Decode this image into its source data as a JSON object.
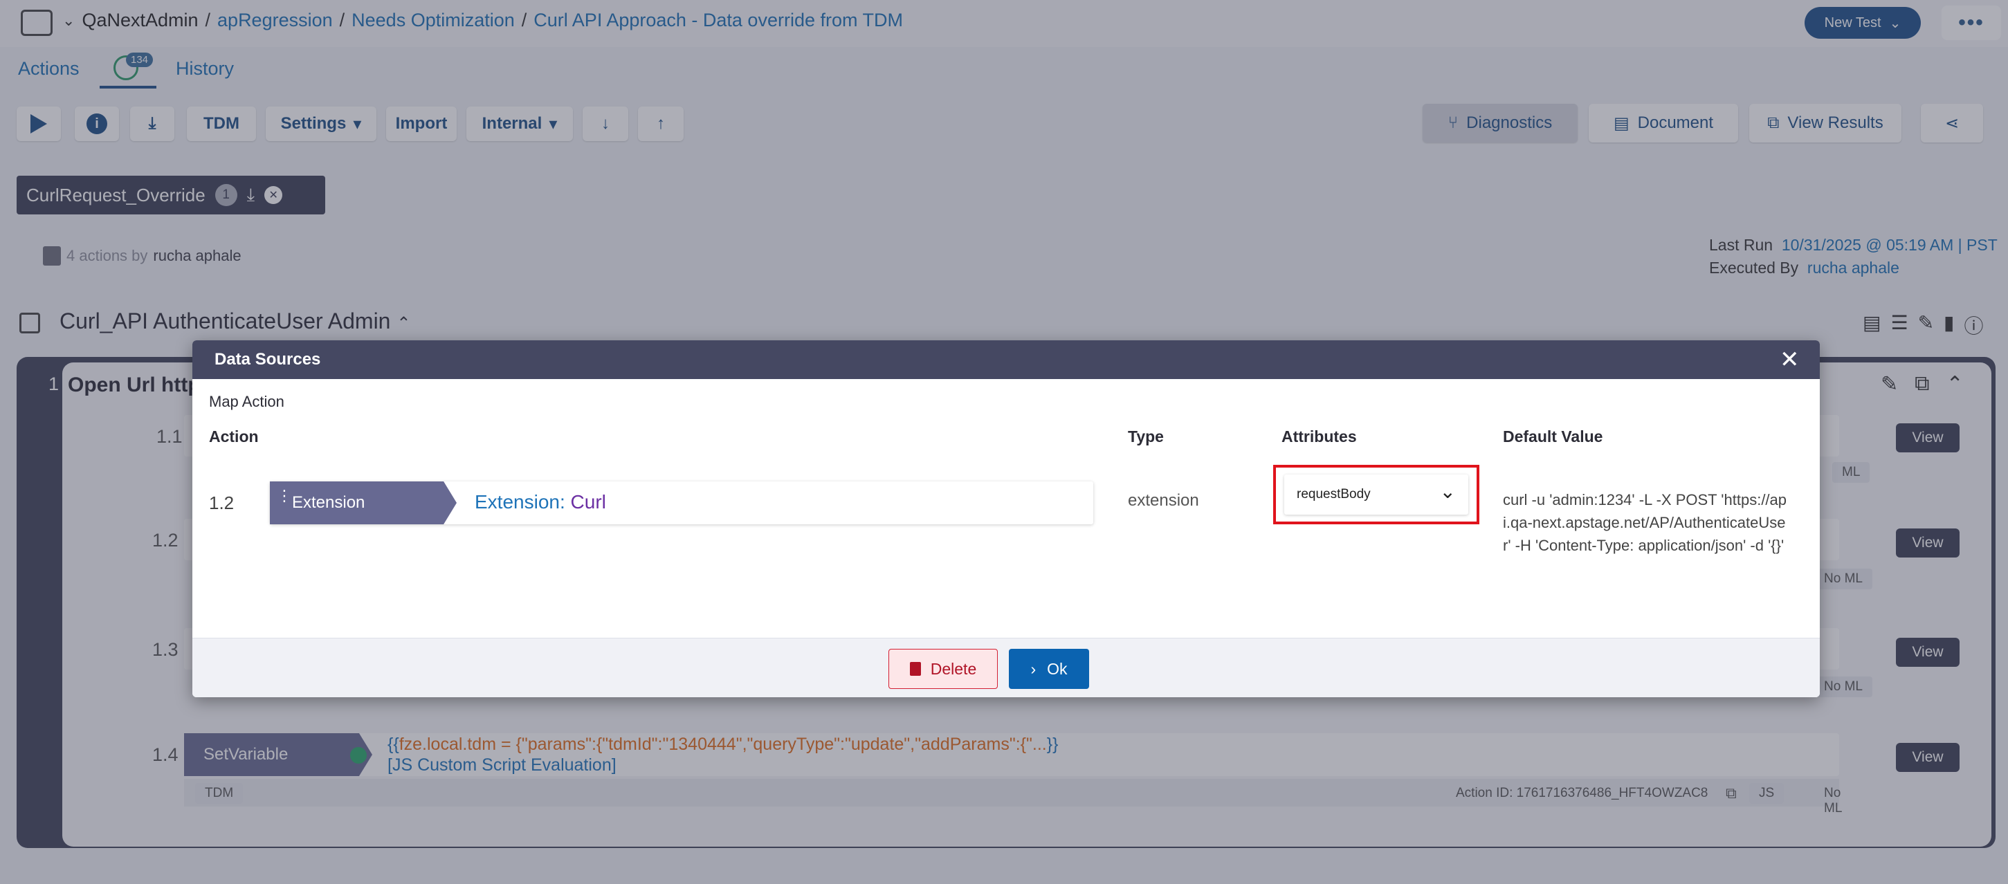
{
  "header": {
    "project": "QaNextAdmin",
    "breadcrumbs": [
      "apRegression",
      "Needs Optimization",
      "Curl API Approach - Data override from TDM"
    ],
    "new_test_label": "New Test",
    "more_label": "•••"
  },
  "tabs": {
    "actions": "Actions",
    "badge": "134",
    "history": "History"
  },
  "toolbar": {
    "tdm": "TDM",
    "settings": "Settings",
    "import": "Import",
    "internal": "Internal",
    "diagnostics": "Diagnostics",
    "document": "Document",
    "view_results": "View Results"
  },
  "datatag": {
    "label": "CurlRequest_Override",
    "count": "1"
  },
  "meta": {
    "actions_text": "4 actions by",
    "author": "rucha aphale"
  },
  "lastrun": {
    "last_run_label": "Last Run",
    "last_run_value": "10/31/2025 @ 05:19 AM | PST",
    "executed_by_label": "Executed By",
    "executed_by_value": "rucha aphale"
  },
  "section": {
    "title": "Curl_API AuthenticateUser Admin"
  },
  "steps": {
    "s1": {
      "num": "1",
      "title": "Open Url http"
    },
    "s11": {
      "num": "1.1",
      "ml": "ML"
    },
    "s12": {
      "num": "1.2",
      "ml": "No ML"
    },
    "s13": {
      "num": "1.3",
      "ml": "No ML"
    },
    "s14": {
      "num": "1.4",
      "tag": "SetVariable",
      "code_line1_open": "{{",
      "code_line1": "fze.local.tdm = {\"params\":{\"tdmId\":\"1340444\",\"queryType\":\"update\",\"addParams\":{\"...",
      "code_line1_close": "}}",
      "code_line2": "[JS Custom Script Evaluation]",
      "tdm": "TDM",
      "action_id": "Action ID: 1761716376486_HFT4OWZAC8",
      "js": "JS",
      "ml": "No ML"
    },
    "view_label": "View"
  },
  "modal": {
    "title": "Data Sources",
    "close": "✕",
    "map_action": "Map Action",
    "col_action": "Action",
    "col_type": "Type",
    "col_attributes": "Attributes",
    "col_default": "Default Value",
    "row": {
      "num": "1.2",
      "tag": "Extension",
      "title_prefix": "Extension:",
      "title_value": "Curl",
      "type": "extension",
      "attribute": "requestBody",
      "default_value": "curl -u 'admin:1234' -L -X POST 'https://api.qa-next.apstage.net/AP/AuthenticateUser' -H 'Content-Type: application/json' -d '{}'"
    },
    "delete_label": "Delete",
    "ok_label": "Ok"
  },
  "colors": {
    "brand": "#1c4e88",
    "link": "#1b6fb3",
    "modal_header": "#454862",
    "highlight": "#e0141c",
    "ok_button": "#0b63b0"
  }
}
